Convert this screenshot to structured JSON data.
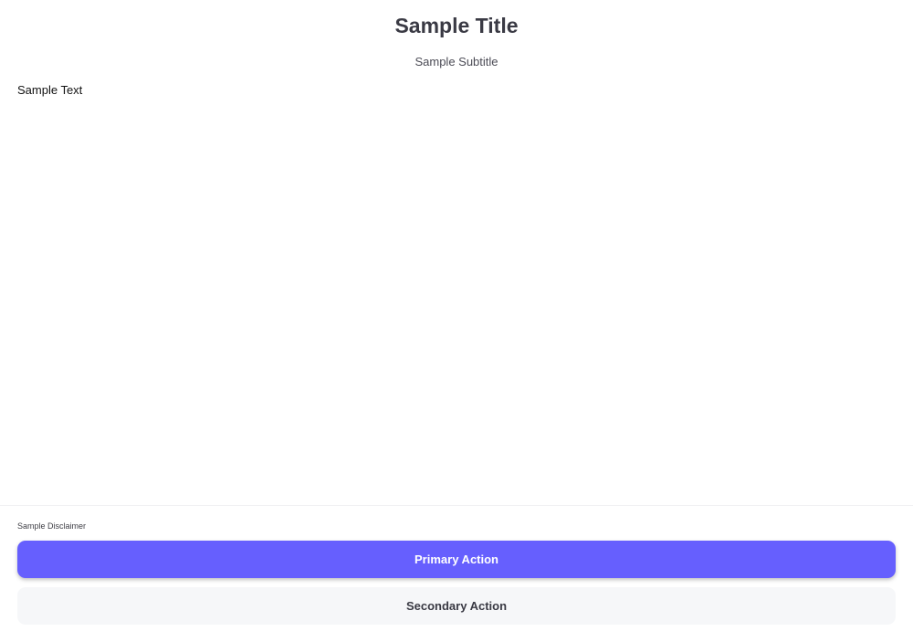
{
  "header": {
    "title": "Sample Title",
    "subtitle": "Sample Subtitle"
  },
  "content": {
    "text": "Sample Text"
  },
  "footer": {
    "disclaimer": "Sample Disclaimer",
    "primary_label": "Primary Action",
    "secondary_label": "Secondary Action"
  },
  "colors": {
    "primary": "#665FFE",
    "secondary_bg": "#F6F7F9",
    "title": "#3A3A44"
  }
}
